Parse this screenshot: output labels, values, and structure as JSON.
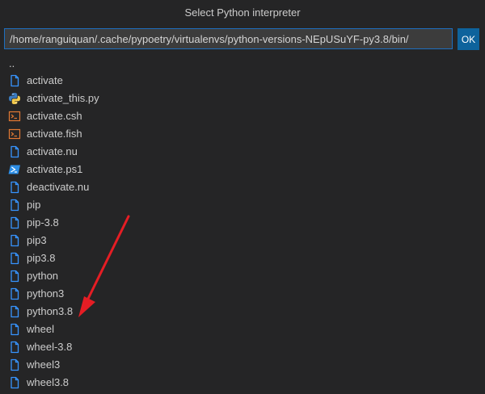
{
  "dialog": {
    "title": "Select Python interpreter",
    "path_value": "/home/ranguiquan/.cache/pypoetry/virtualenvs/python-versions-NEpUSuYF-py3.8/bin/",
    "ok_label": "OK"
  },
  "parent_dir": "..",
  "files": [
    {
      "name": "activate",
      "icon": "file-icon"
    },
    {
      "name": "activate_this.py",
      "icon": "python-icon"
    },
    {
      "name": "activate.csh",
      "icon": "terminal-icon"
    },
    {
      "name": "activate.fish",
      "icon": "terminal-icon"
    },
    {
      "name": "activate.nu",
      "icon": "file-icon"
    },
    {
      "name": "activate.ps1",
      "icon": "powershell-icon"
    },
    {
      "name": "deactivate.nu",
      "icon": "file-icon"
    },
    {
      "name": "pip",
      "icon": "file-icon"
    },
    {
      "name": "pip-3.8",
      "icon": "file-icon"
    },
    {
      "name": "pip3",
      "icon": "file-icon"
    },
    {
      "name": "pip3.8",
      "icon": "file-icon"
    },
    {
      "name": "python",
      "icon": "file-icon"
    },
    {
      "name": "python3",
      "icon": "file-icon"
    },
    {
      "name": "python3.8",
      "icon": "file-icon"
    },
    {
      "name": "wheel",
      "icon": "file-icon"
    },
    {
      "name": "wheel-3.8",
      "icon": "file-icon"
    },
    {
      "name": "wheel3",
      "icon": "file-icon"
    },
    {
      "name": "wheel3.8",
      "icon": "file-icon"
    }
  ],
  "colors": {
    "background": "#252526",
    "accent": "#0e639c",
    "file_icon": "#3794ff",
    "terminal_icon": "#e37933",
    "annotation_arrow": "#e51d24"
  }
}
